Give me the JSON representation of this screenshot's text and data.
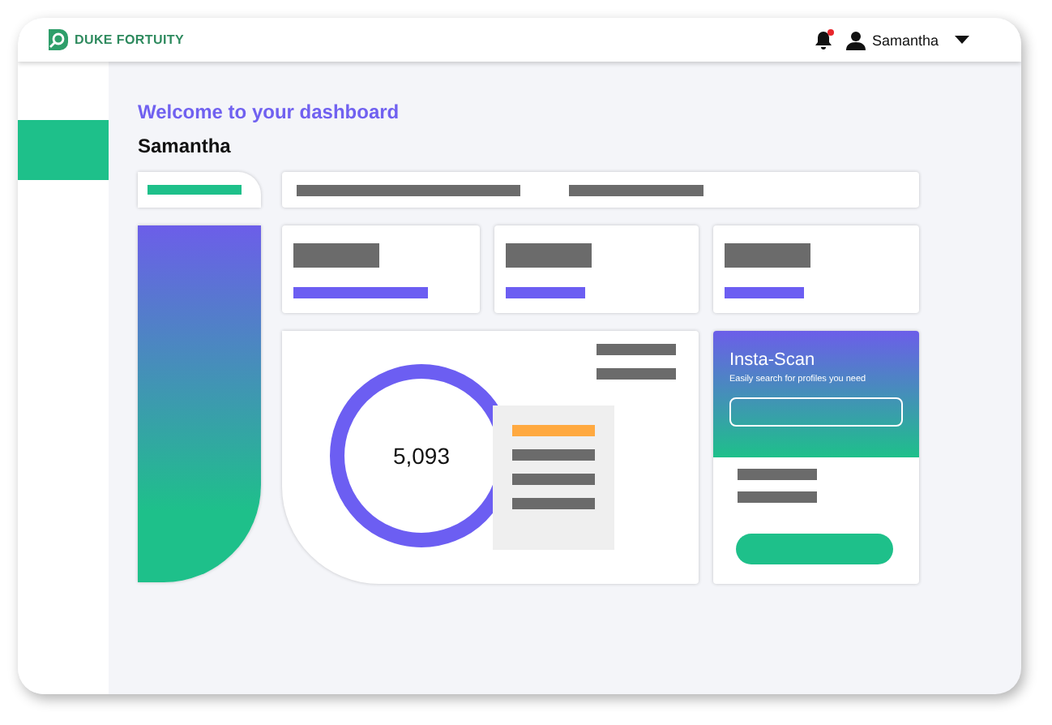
{
  "brand": {
    "name": "DUKE FORTUITY"
  },
  "header": {
    "notifications": {
      "unread": true
    },
    "user": "Samantha"
  },
  "welcome": {
    "greeting": "Welcome to your dashboard",
    "name": "Samantha"
  },
  "summary": {
    "value": "5,093"
  },
  "insta_scan": {
    "title": "Insta-Scan",
    "subtitle": "Easily search for profiles you need"
  }
}
